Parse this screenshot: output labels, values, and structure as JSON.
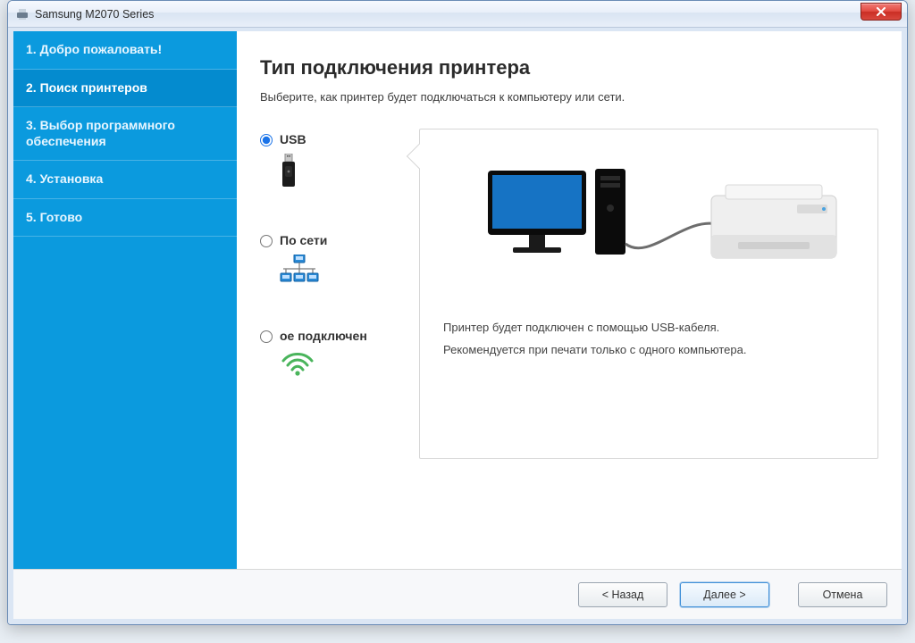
{
  "window": {
    "title": "Samsung M2070 Series"
  },
  "sidebar": {
    "steps": [
      {
        "label": "1. Добро пожаловать!"
      },
      {
        "label": "2. Поиск принтеров"
      },
      {
        "label": "3. Выбор программного обеспечения"
      },
      {
        "label": "4. Установка"
      },
      {
        "label": "5. Готово"
      }
    ],
    "active_index": 1
  },
  "main": {
    "heading": "Тип подключения принтера",
    "subtitle": "Выберите, как принтер будет подключаться к компьютеру или сети."
  },
  "options": {
    "usb": {
      "label": "USB",
      "checked": true
    },
    "network": {
      "label": "По сети",
      "checked": false
    },
    "wireless": {
      "label": "ое подключен",
      "checked": false
    }
  },
  "preview": {
    "line1": "Принтер будет подключен с помощью USB-кабеля.",
    "line2": "Рекомендуется при печати только с одного компьютера."
  },
  "footer": {
    "back": "< Назад",
    "next": "Далее >",
    "cancel": "Отмена"
  }
}
